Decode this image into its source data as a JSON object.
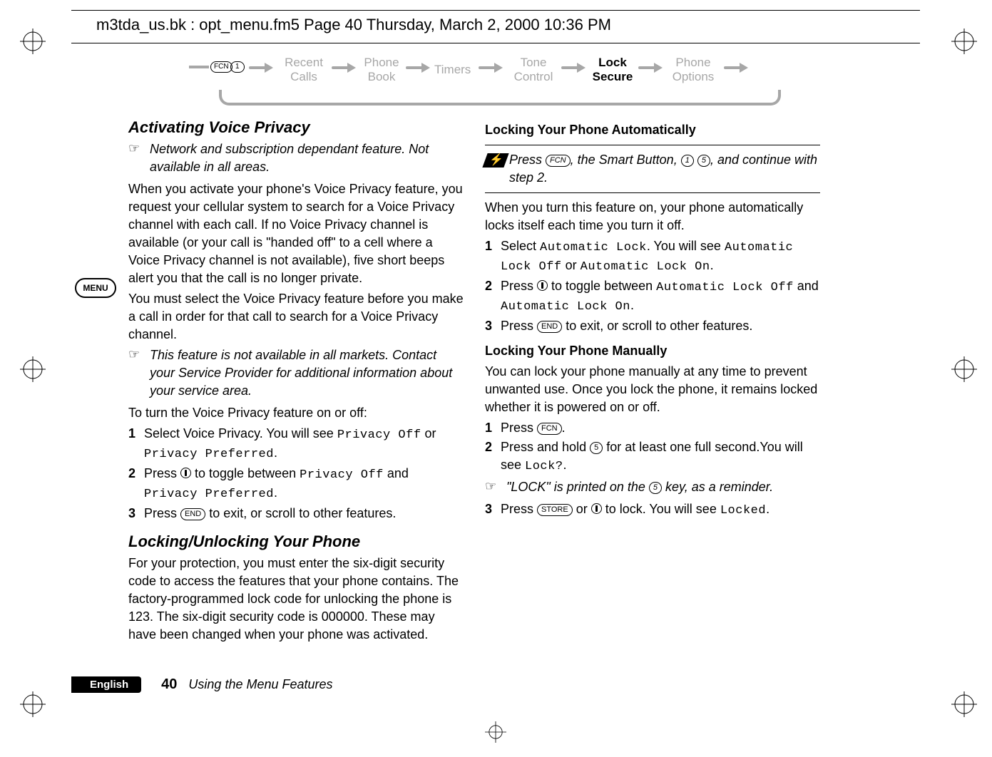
{
  "header_line": "m3tda_us.bk : opt_menu.fm5  Page 40  Thursday, March 2, 2000  10:36 PM",
  "breadcrumb": {
    "fcn": "FCN",
    "one": "1",
    "items": [
      "Recent Calls",
      "Phone Book",
      "Timers",
      "Tone Control",
      "Lock Secure",
      "Phone Options"
    ],
    "active_index": 4
  },
  "menu_badge": "MENU",
  "left": {
    "title1": "Activating Voice Privacy",
    "note1": "Network and subscription dependant feature. Not available in all areas.",
    "p1": "When you activate your phone's Voice Privacy feature, you request your cellular system to search for a Voice Privacy channel with each call. If no Voice Privacy channel is available (or your call is \"handed off\" to a cell where a Voice Privacy channel is not available), five short beeps alert you that the call is no longer private.",
    "p2": "You must select the Voice Privacy feature before you make a call in order for that call to search for a Voice Privacy channel.",
    "note2": "This feature is not available in all markets. Contact your Service Provider for additional information about your service area.",
    "p3": "To turn the Voice Privacy feature on or off:",
    "s1a": "Select Voice Privacy. You will see ",
    "s1b": "Privacy Off",
    "s1c": " or ",
    "s1d": "Privacy Preferred",
    "s1e": ".",
    "s2a": "Press ",
    "s2b": " to toggle between ",
    "s2c": "Privacy Off",
    "s2d": " and ",
    "s2e": "Privacy Preferred",
    "s2f": ".",
    "s3a": "Press ",
    "s3b": " to exit, or scroll to other features.",
    "title2": "Locking/Unlocking Your Phone",
    "p4": "For your protection, you must enter the six-digit security code to access the features that your phone contains. The factory-programmed lock code for unlocking the phone is 123. The six-digit security code is 000000. These may have been changed when your phone was activated."
  },
  "right": {
    "sub1": "Locking Your Phone Automatically",
    "flash_a": "Press ",
    "flash_b": ", the Smart Button, ",
    "flash_c": ", and continue with step 2.",
    "p1": "When you turn this feature on, your phone automatically locks itself each time you turn it off.",
    "s1a": "Select ",
    "s1b": "Automatic Lock",
    "s1c": ". You will see ",
    "s1d": "Automatic Lock Off",
    "s1e": " or ",
    "s1f": "Automatic Lock On",
    "s1g": ".",
    "s2a": "Press ",
    "s2b": " to toggle between ",
    "s2c": "Automatic Lock Off",
    "s2d": " and ",
    "s2e": "Automatic Lock On",
    "s2f": ".",
    "s3a": "Press ",
    "s3b": " to exit, or scroll to other features.",
    "sub2": "Locking Your Phone Manually",
    "p2": "You can lock your phone manually at any time to prevent unwanted use. Once you lock the phone, it remains locked whether it is powered on or off.",
    "m1a": "Press ",
    "m1b": ".",
    "m2a": "Press and hold ",
    "m2b": " for at least one full second.You will see ",
    "m2c": "Lock?",
    "m2d": ".",
    "note1a": "\"LOCK\" is printed on the ",
    "note1b": " key, as a reminder.",
    "m3a": "Press ",
    "m3b": " or ",
    "m3c": " to lock. You will see ",
    "m3d": "Locked",
    "m3e": "."
  },
  "keys": {
    "fcn": "FCN",
    "end": "END",
    "store": "STORE",
    "one": "1",
    "five": "5"
  },
  "footer": {
    "lang": "English",
    "page": "40",
    "title": "Using the Menu Features"
  }
}
